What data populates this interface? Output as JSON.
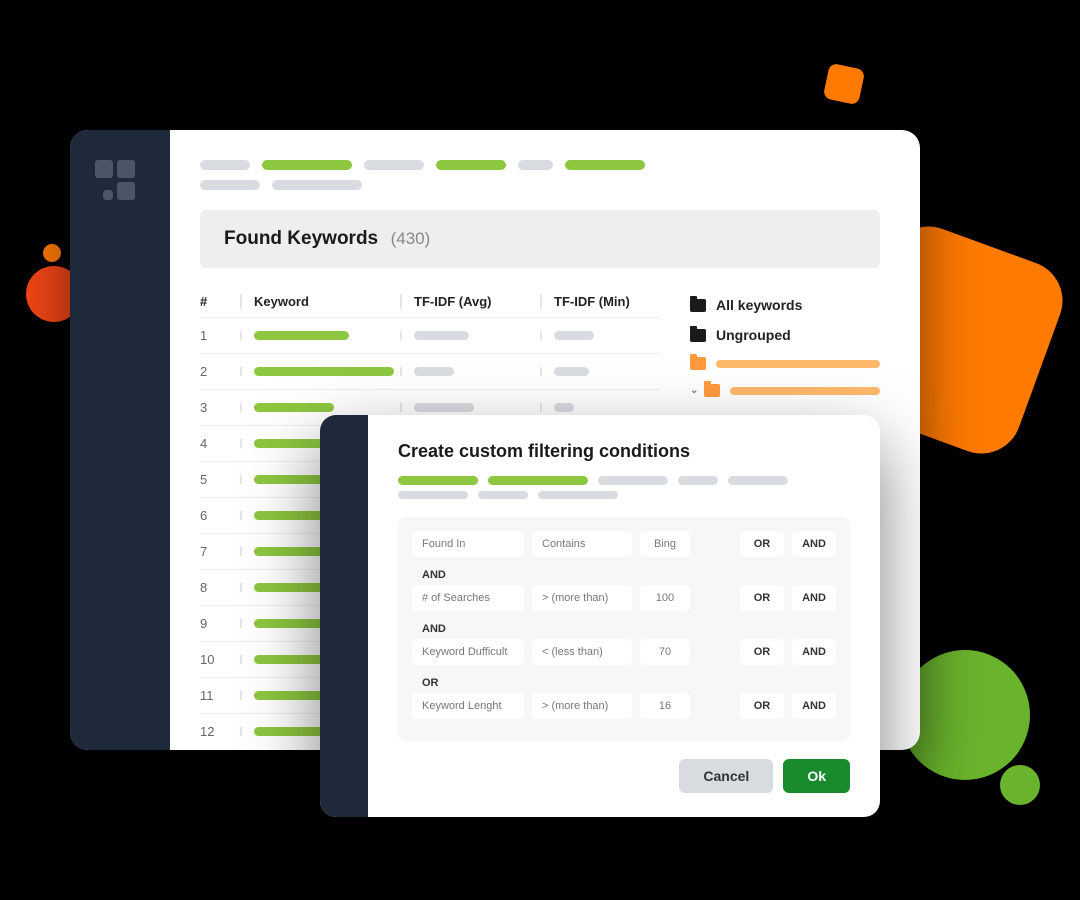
{
  "header": {
    "title": "Found Keywords",
    "count": "(430)"
  },
  "table": {
    "columns": {
      "num": "#",
      "keyword": "Keyword",
      "avg": "TF-IDF (Avg)",
      "min": "TF-IDF (Min)"
    },
    "rows": [
      {
        "n": "1",
        "kw_w": 95,
        "avg_w": 55,
        "min_w": 40
      },
      {
        "n": "2",
        "kw_w": 140,
        "avg_w": 40,
        "min_w": 35
      },
      {
        "n": "3",
        "kw_w": 80,
        "avg_w": 60,
        "min_w": 20
      },
      {
        "n": "4",
        "kw_w": 110,
        "avg_w": 50,
        "min_w": 45
      },
      {
        "n": "5",
        "kw_w": 95,
        "avg_w": 45,
        "min_w": 30
      },
      {
        "n": "6",
        "kw_w": 70,
        "avg_w": 55,
        "min_w": 40
      },
      {
        "n": "7",
        "kw_w": 100,
        "avg_w": 40,
        "min_w": 35
      },
      {
        "n": "8",
        "kw_w": 120,
        "avg_w": 50,
        "min_w": 30
      },
      {
        "n": "9",
        "kw_w": 85,
        "avg_w": 45,
        "min_w": 40
      },
      {
        "n": "10",
        "kw_w": 105,
        "avg_w": 55,
        "min_w": 35
      },
      {
        "n": "11",
        "kw_w": 90,
        "avg_w": 50,
        "min_w": 30
      },
      {
        "n": "12",
        "kw_w": 115,
        "avg_w": 45,
        "min_w": 40
      }
    ]
  },
  "folders": {
    "all": "All keywords",
    "ungrouped": "Ungrouped"
  },
  "modal": {
    "title": "Create custom filtering conditions",
    "conditions": [
      {
        "field": "Found In",
        "op": "Contains",
        "val": "Bing",
        "or": "OR",
        "and": "AND"
      },
      {
        "join": "AND"
      },
      {
        "field": "# of Searches",
        "op": "> (more than)",
        "val": "100",
        "or": "OR",
        "and": "AND"
      },
      {
        "join": "AND"
      },
      {
        "field": "Keyword Dufficult",
        "op": "< (less than)",
        "val": "70",
        "or": "OR",
        "and": "AND"
      },
      {
        "join": "OR"
      },
      {
        "field": "Keyword Lenght",
        "op": "> (more than)",
        "val": "16",
        "or": "OR",
        "and": "AND"
      }
    ],
    "cancel": "Cancel",
    "ok": "Ok"
  }
}
